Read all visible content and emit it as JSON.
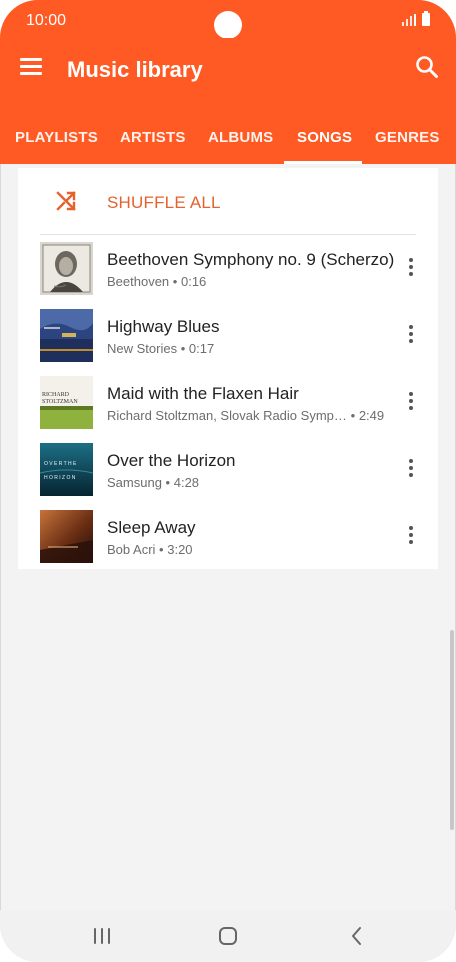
{
  "status": {
    "time": "10:00"
  },
  "appbar": {
    "title": "Music library",
    "menu_icon": "menu-icon",
    "search_icon": "search-icon",
    "color": "#ff5a24"
  },
  "tabs": [
    {
      "label": "PLAYLISTS"
    },
    {
      "label": "ARTISTS"
    },
    {
      "label": "ALBUMS"
    },
    {
      "label": "SONGS",
      "selected": true
    },
    {
      "label": "GENRES"
    }
  ],
  "shuffle": {
    "label": "SHUFFLE ALL",
    "icon": "shuffle-icon",
    "color": "#e4622d"
  },
  "songs": [
    {
      "title": "Beethoven Symphony no. 9 (Scherzo)",
      "artist": "Beethoven",
      "separator": "•",
      "duration": "0:16"
    },
    {
      "title": "Highway Blues",
      "artist": "New Stories",
      "separator": "•",
      "duration": "0:17"
    },
    {
      "title": "Maid with the Flaxen Hair",
      "artist": "Richard Stoltzman, Slovak Radio Symphony Orchestra",
      "separator": "•",
      "duration": "2:49"
    },
    {
      "title": "Over the Horizon",
      "artist": "Samsung",
      "separator": "•",
      "duration": "4:28"
    },
    {
      "title": "Sleep Away",
      "artist": "Bob Acri",
      "separator": "•",
      "duration": "3:20"
    }
  ],
  "album_art": {
    "horizon_text_1": "O V E R   T H E",
    "horizon_text_2": "H O R I Z O N",
    "stoltzman_text_1": "RICHARD",
    "stoltzman_text_2": "STOLTZMAN"
  },
  "navbar": {
    "recents_icon": "recent-apps-icon",
    "home_icon": "home-icon",
    "back_icon": "back-icon"
  }
}
